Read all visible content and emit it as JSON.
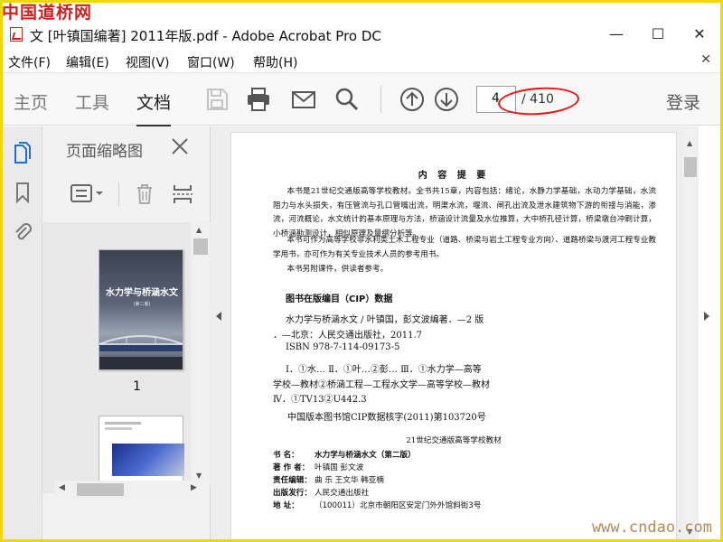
{
  "watermark": {
    "top": "中国道桥网",
    "bottom": "www.cndao.com"
  },
  "window": {
    "title": "文 [叶镇国编著] 2011年版.pdf - Adobe Acrobat Pro DC",
    "minimize": "—",
    "maximize": "☐",
    "close": "✕"
  },
  "menu": {
    "items": [
      "文件(F)",
      "编辑(E)",
      "视图(V)",
      "窗口(W)",
      "帮助(H)"
    ],
    "close_doc": "✕"
  },
  "toolbar": {
    "tabs": [
      "主页",
      "工具",
      "文档"
    ],
    "active_tab": "文档",
    "page_current": "4",
    "page_total": "/ 410",
    "login": "登录",
    "highlight_color": "#e11111"
  },
  "panel": {
    "title": "页面缩略图",
    "thumbnail_label": "1",
    "cover_title": "水力学与桥涵水文",
    "cover_edition": "(第二版)"
  },
  "page": {
    "heading": "内 容 提 要",
    "paragraphs": [
      "本书是21世纪交通版高等学校教材。全书共15章，内容包括：绪论，水静力学基础，水动力学基础，水流阻力与水头损失，有压管流与孔口管嘴出流，明渠水流，堰流、闸孔出流及泄水建筑物下游的衔接与消能，渗流，河流概论，水文统计的基本原理与方法，桥涵设计流量及水位推算，大中桥孔径计算，桥梁墩台冲刷计算，小桥涵勘测设计，相似原理及量纲分析等。",
      "本书可作为高等学校非水利类土木工程专业（道路、桥梁与岩土工程专业方向）、道路桥梁与渡河工程专业教学用书，亦可作为有关专业技术人员的参考用书。",
      "本书另附课件，供读者参考。"
    ],
    "cip_title": "图书在版编目（CIP）数据",
    "cip_lines": [
      "水力学与桥涵水文 / 叶镇国，彭文波编著．—2 版",
      "．—北京：人民交通出版社，2011.7",
      "ISBN 978-7-114-09173-5",
      "Ⅰ．①水…  Ⅱ．①叶…②彭…  Ⅲ．①水力学—高等",
      "学校—教材②桥涵工程—工程水文学—高等学校—教材",
      "Ⅳ．①TV13②U442.3"
    ],
    "cip_number": "中国版本图书馆CIP数据核字(2011)第103720号",
    "series": "21世纪交通版高等学校教材",
    "info": [
      {
        "label": "书    名：",
        "value": "水力学与桥涵水文（第二版）"
      },
      {
        "label": "著 作 者：",
        "value": "叶镇国    彭文波"
      },
      {
        "label": "责任编辑：",
        "value": "曲    乐    王文华    韩亚楠"
      },
      {
        "label": "出版发行：",
        "value": "人民交通出版社"
      },
      {
        "label": "地    址：",
        "value": "（100011）北京市朝阳区安定门外外馆斜街3号"
      }
    ]
  }
}
